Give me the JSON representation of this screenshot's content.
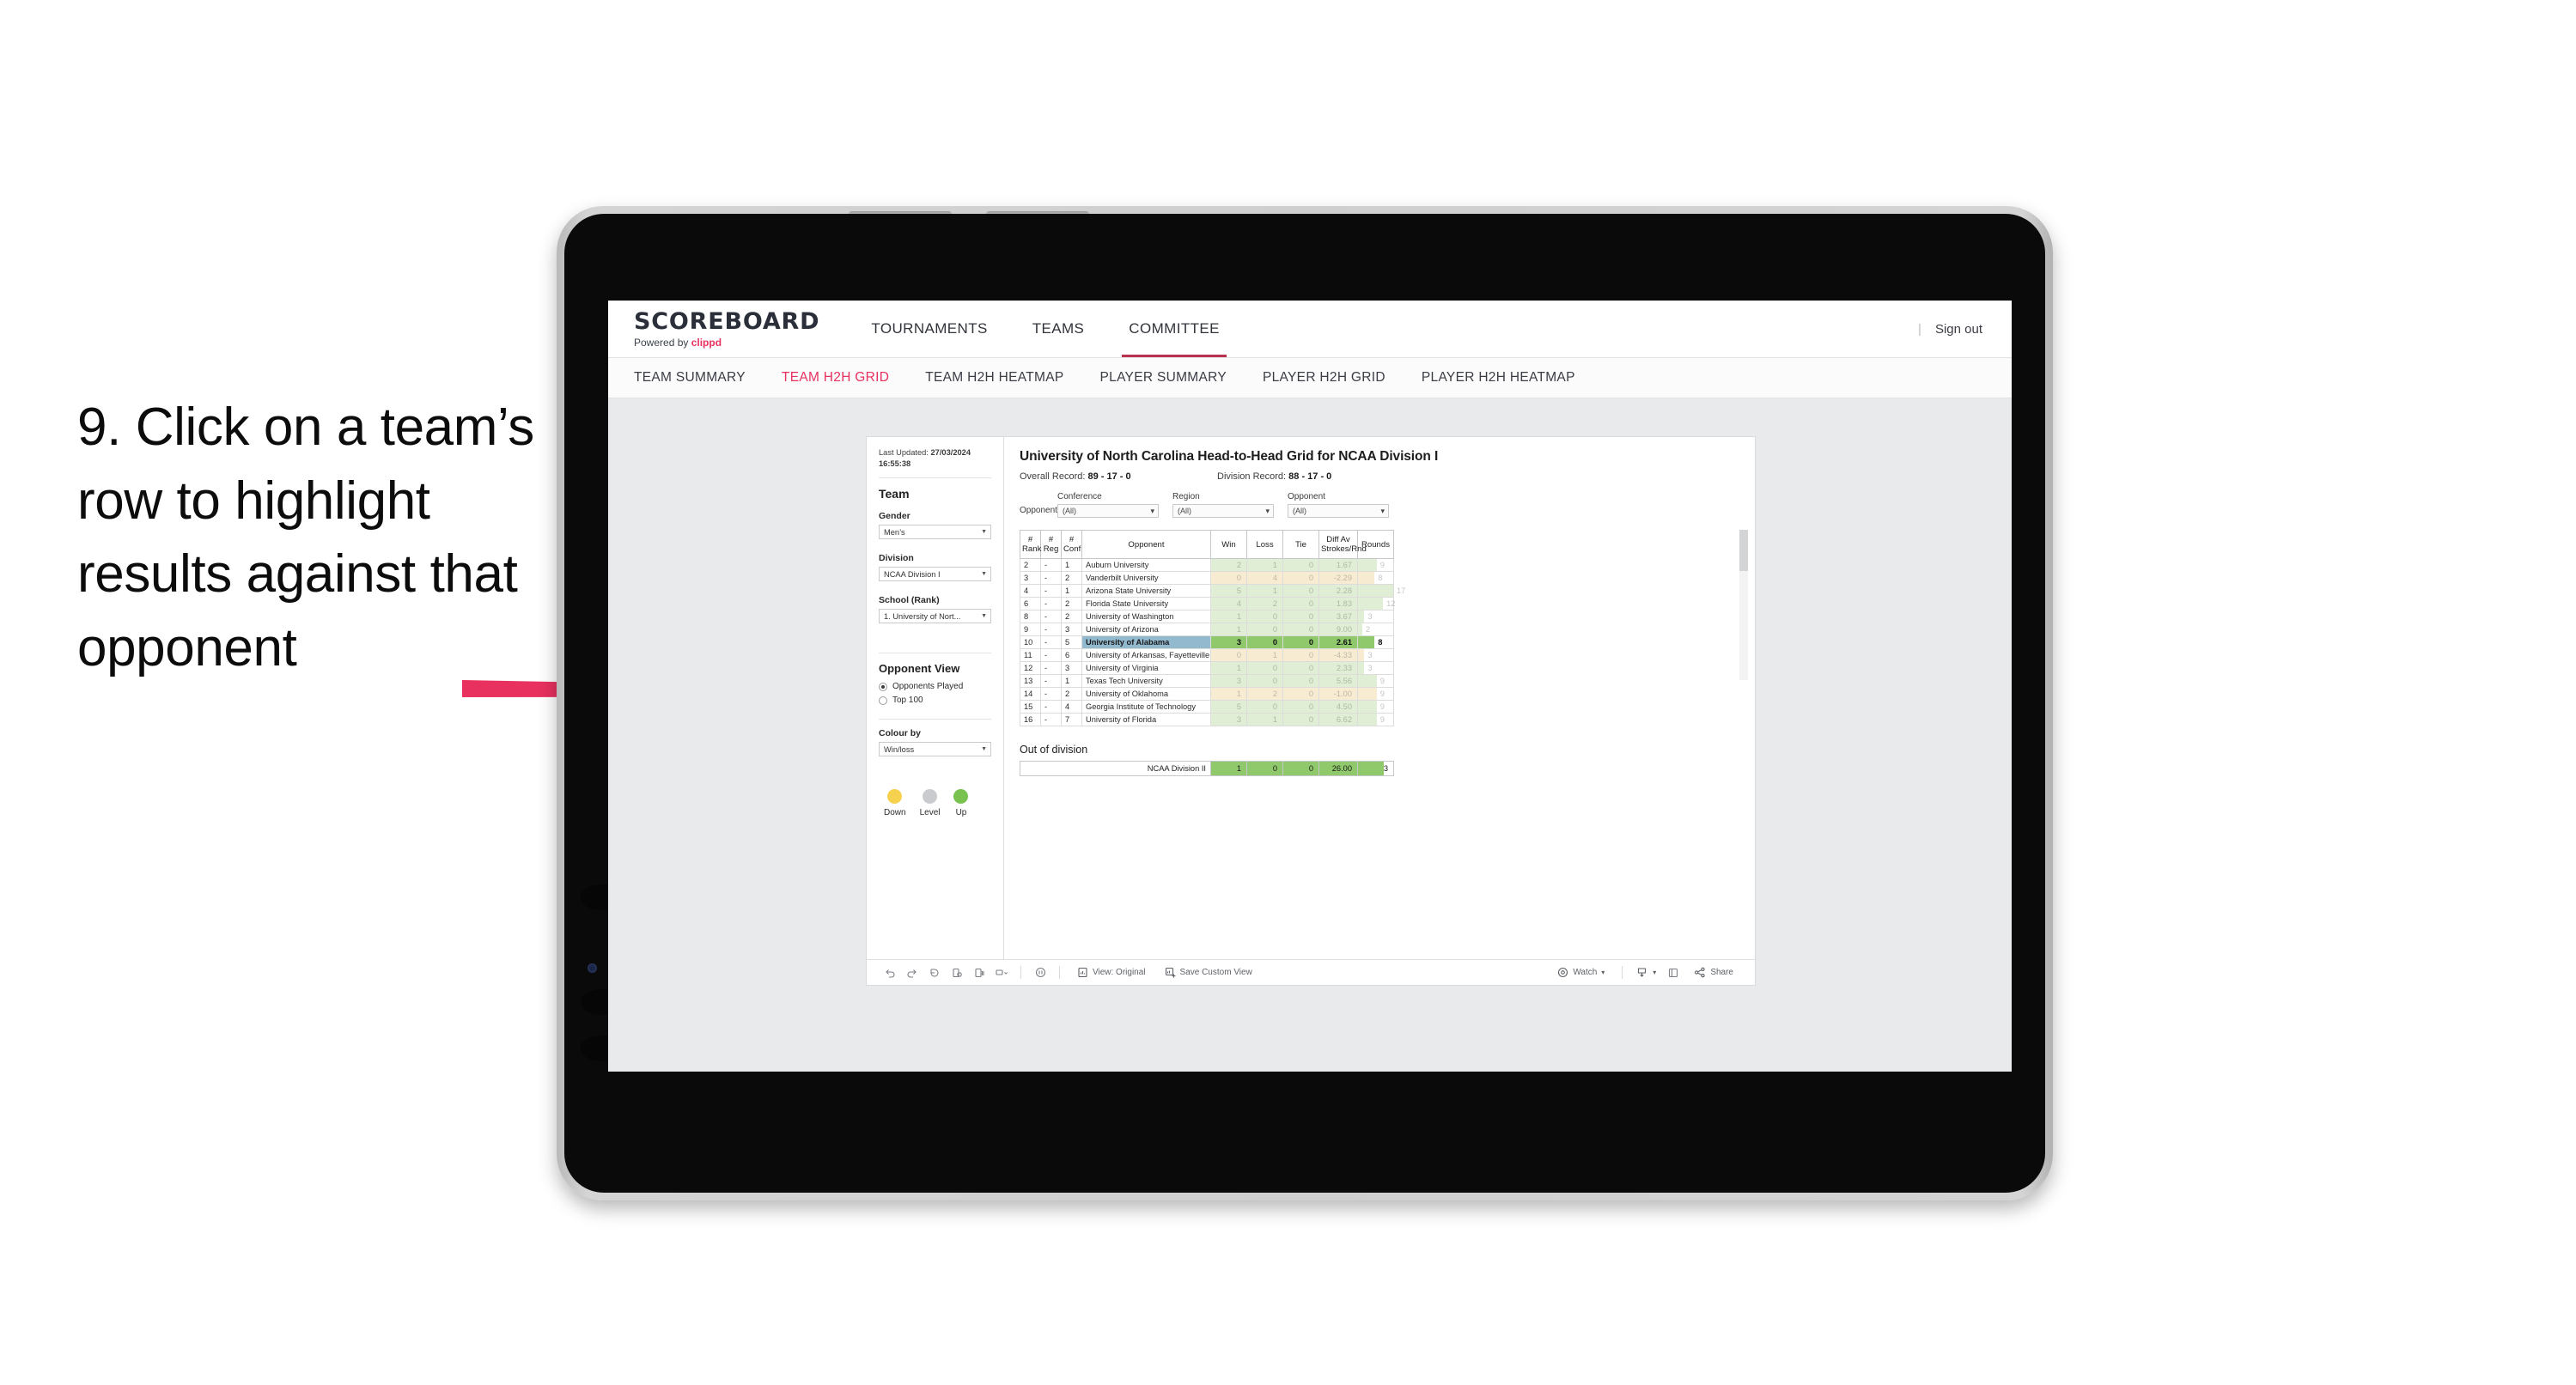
{
  "annotation": {
    "step_text": "9. Click on a team’s row to highlight results against that opponent",
    "arrow_color": "#e8315f"
  },
  "app": {
    "brand": {
      "title": "SCOREBOARD",
      "powered_prefix": "Powered by",
      "powered_brand": "clippd"
    },
    "top_nav": [
      {
        "label": "TOURNAMENTS",
        "active": false
      },
      {
        "label": "TEAMS",
        "active": false
      },
      {
        "label": "COMMITTEE",
        "active": true
      }
    ],
    "sign_out": "Sign out",
    "sub_nav": [
      {
        "label": "TEAM SUMMARY",
        "active": false
      },
      {
        "label": "TEAM H2H GRID",
        "active": true
      },
      {
        "label": "TEAM H2H HEATMAP",
        "active": false
      },
      {
        "label": "PLAYER SUMMARY",
        "active": false
      },
      {
        "label": "PLAYER H2H GRID",
        "active": false
      },
      {
        "label": "PLAYER H2H HEATMAP",
        "active": false
      }
    ]
  },
  "sidebar": {
    "last_updated_label": "Last Updated:",
    "last_updated_value": "27/03/2024 16:55:38",
    "team_heading": "Team",
    "gender": {
      "label": "Gender",
      "value": "Men’s"
    },
    "division": {
      "label": "Division",
      "value": "NCAA Division I"
    },
    "school": {
      "label": "School (Rank)",
      "value": "1. University of Nort..."
    },
    "opponent_view": {
      "heading": "Opponent View",
      "options": [
        {
          "label": "Opponents Played",
          "selected": true
        },
        {
          "label": "Top 100",
          "selected": false
        }
      ]
    },
    "colour_by": {
      "label": "Colour by",
      "value": "Win/loss"
    },
    "legend": [
      {
        "label": "Down",
        "color": "#f5d14e"
      },
      {
        "label": "Level",
        "color": "#c9cbce"
      },
      {
        "label": "Up",
        "color": "#79c24f"
      }
    ]
  },
  "view": {
    "title": "University of North Carolina Head-to-Head Grid for NCAA Division I",
    "overall_record_label": "Overall Record:",
    "overall_record_value": "89 - 17 - 0",
    "division_record_label": "Division Record:",
    "division_record_value": "88 - 17 - 0",
    "opponents_label": "Opponents:",
    "filters": [
      {
        "label": "Conference",
        "value": "(All)"
      },
      {
        "label": "Region",
        "value": "(All)"
      },
      {
        "label": "Opponent",
        "value": "(All)"
      }
    ]
  },
  "chart_data": {
    "type": "table",
    "title": "University of North Carolina Head-to-Head Grid for NCAA Division I",
    "columns": [
      "# Rank",
      "# Reg",
      "# Conf",
      "Opponent",
      "Win",
      "Loss",
      "Tie",
      "Diff Av Strokes/Rnd",
      "Rounds"
    ],
    "selected_row_opponent": "University of Alabama",
    "rows": [
      {
        "rank": "2",
        "reg": "-",
        "conf": "1",
        "opponent": "Auburn University",
        "win": "2",
        "loss": "1",
        "tie": "0",
        "diff": "1.67",
        "rounds": "9",
        "tone": "up"
      },
      {
        "rank": "3",
        "reg": "-",
        "conf": "2",
        "opponent": "Vanderbilt University",
        "win": "0",
        "loss": "4",
        "tie": "0",
        "diff": "-2.29",
        "rounds": "8",
        "tone": "down"
      },
      {
        "rank": "4",
        "reg": "-",
        "conf": "1",
        "opponent": "Arizona State University",
        "win": "5",
        "loss": "1",
        "tie": "0",
        "diff": "2.28",
        "rounds": "17",
        "tone": "up"
      },
      {
        "rank": "6",
        "reg": "-",
        "conf": "2",
        "opponent": "Florida State University",
        "win": "4",
        "loss": "2",
        "tie": "0",
        "diff": "1.83",
        "rounds": "12",
        "tone": "up"
      },
      {
        "rank": "8",
        "reg": "-",
        "conf": "2",
        "opponent": "University of Washington",
        "win": "1",
        "loss": "0",
        "tie": "0",
        "diff": "3.67",
        "rounds": "3",
        "tone": "up"
      },
      {
        "rank": "9",
        "reg": "-",
        "conf": "3",
        "opponent": "University of Arizona",
        "win": "1",
        "loss": "0",
        "tie": "0",
        "diff": "9.00",
        "rounds": "2",
        "tone": "up"
      },
      {
        "rank": "10",
        "reg": "-",
        "conf": "5",
        "opponent": "University of Alabama",
        "win": "3",
        "loss": "0",
        "tie": "0",
        "diff": "2.61",
        "rounds": "8",
        "tone": "up",
        "selected": true
      },
      {
        "rank": "11",
        "reg": "-",
        "conf": "6",
        "opponent": "University of Arkansas, Fayetteville",
        "win": "0",
        "loss": "1",
        "tie": "0",
        "diff": "-4.33",
        "rounds": "3",
        "tone": "down"
      },
      {
        "rank": "12",
        "reg": "-",
        "conf": "3",
        "opponent": "University of Virginia",
        "win": "1",
        "loss": "0",
        "tie": "0",
        "diff": "2.33",
        "rounds": "3",
        "tone": "up"
      },
      {
        "rank": "13",
        "reg": "-",
        "conf": "1",
        "opponent": "Texas Tech University",
        "win": "3",
        "loss": "0",
        "tie": "0",
        "diff": "5.56",
        "rounds": "9",
        "tone": "up"
      },
      {
        "rank": "14",
        "reg": "-",
        "conf": "2",
        "opponent": "University of Oklahoma",
        "win": "1",
        "loss": "2",
        "tie": "0",
        "diff": "-1.00",
        "rounds": "9",
        "tone": "down"
      },
      {
        "rank": "15",
        "reg": "-",
        "conf": "4",
        "opponent": "Georgia Institute of Technology",
        "win": "5",
        "loss": "0",
        "tie": "0",
        "diff": "4.50",
        "rounds": "9",
        "tone": "up"
      },
      {
        "rank": "16",
        "reg": "-",
        "conf": "7",
        "opponent": "University of Florida",
        "win": "3",
        "loss": "1",
        "tie": "0",
        "diff": "6.62",
        "rounds": "9",
        "tone": "up"
      }
    ],
    "out_of_division": {
      "title": "Out of division",
      "row": {
        "label": "NCAA Division II",
        "win": "1",
        "loss": "0",
        "tie": "0",
        "diff": "26.00",
        "rounds": "3"
      }
    },
    "colors": {
      "up": "#90c96c",
      "down": "#f5e4ba",
      "selected_row": "#93b9cf",
      "bar_up": "#90c96c"
    }
  },
  "toolbar": {
    "view_original": "View: Original",
    "save_custom_view": "Save Custom View",
    "watch": "Watch",
    "share": "Share"
  }
}
